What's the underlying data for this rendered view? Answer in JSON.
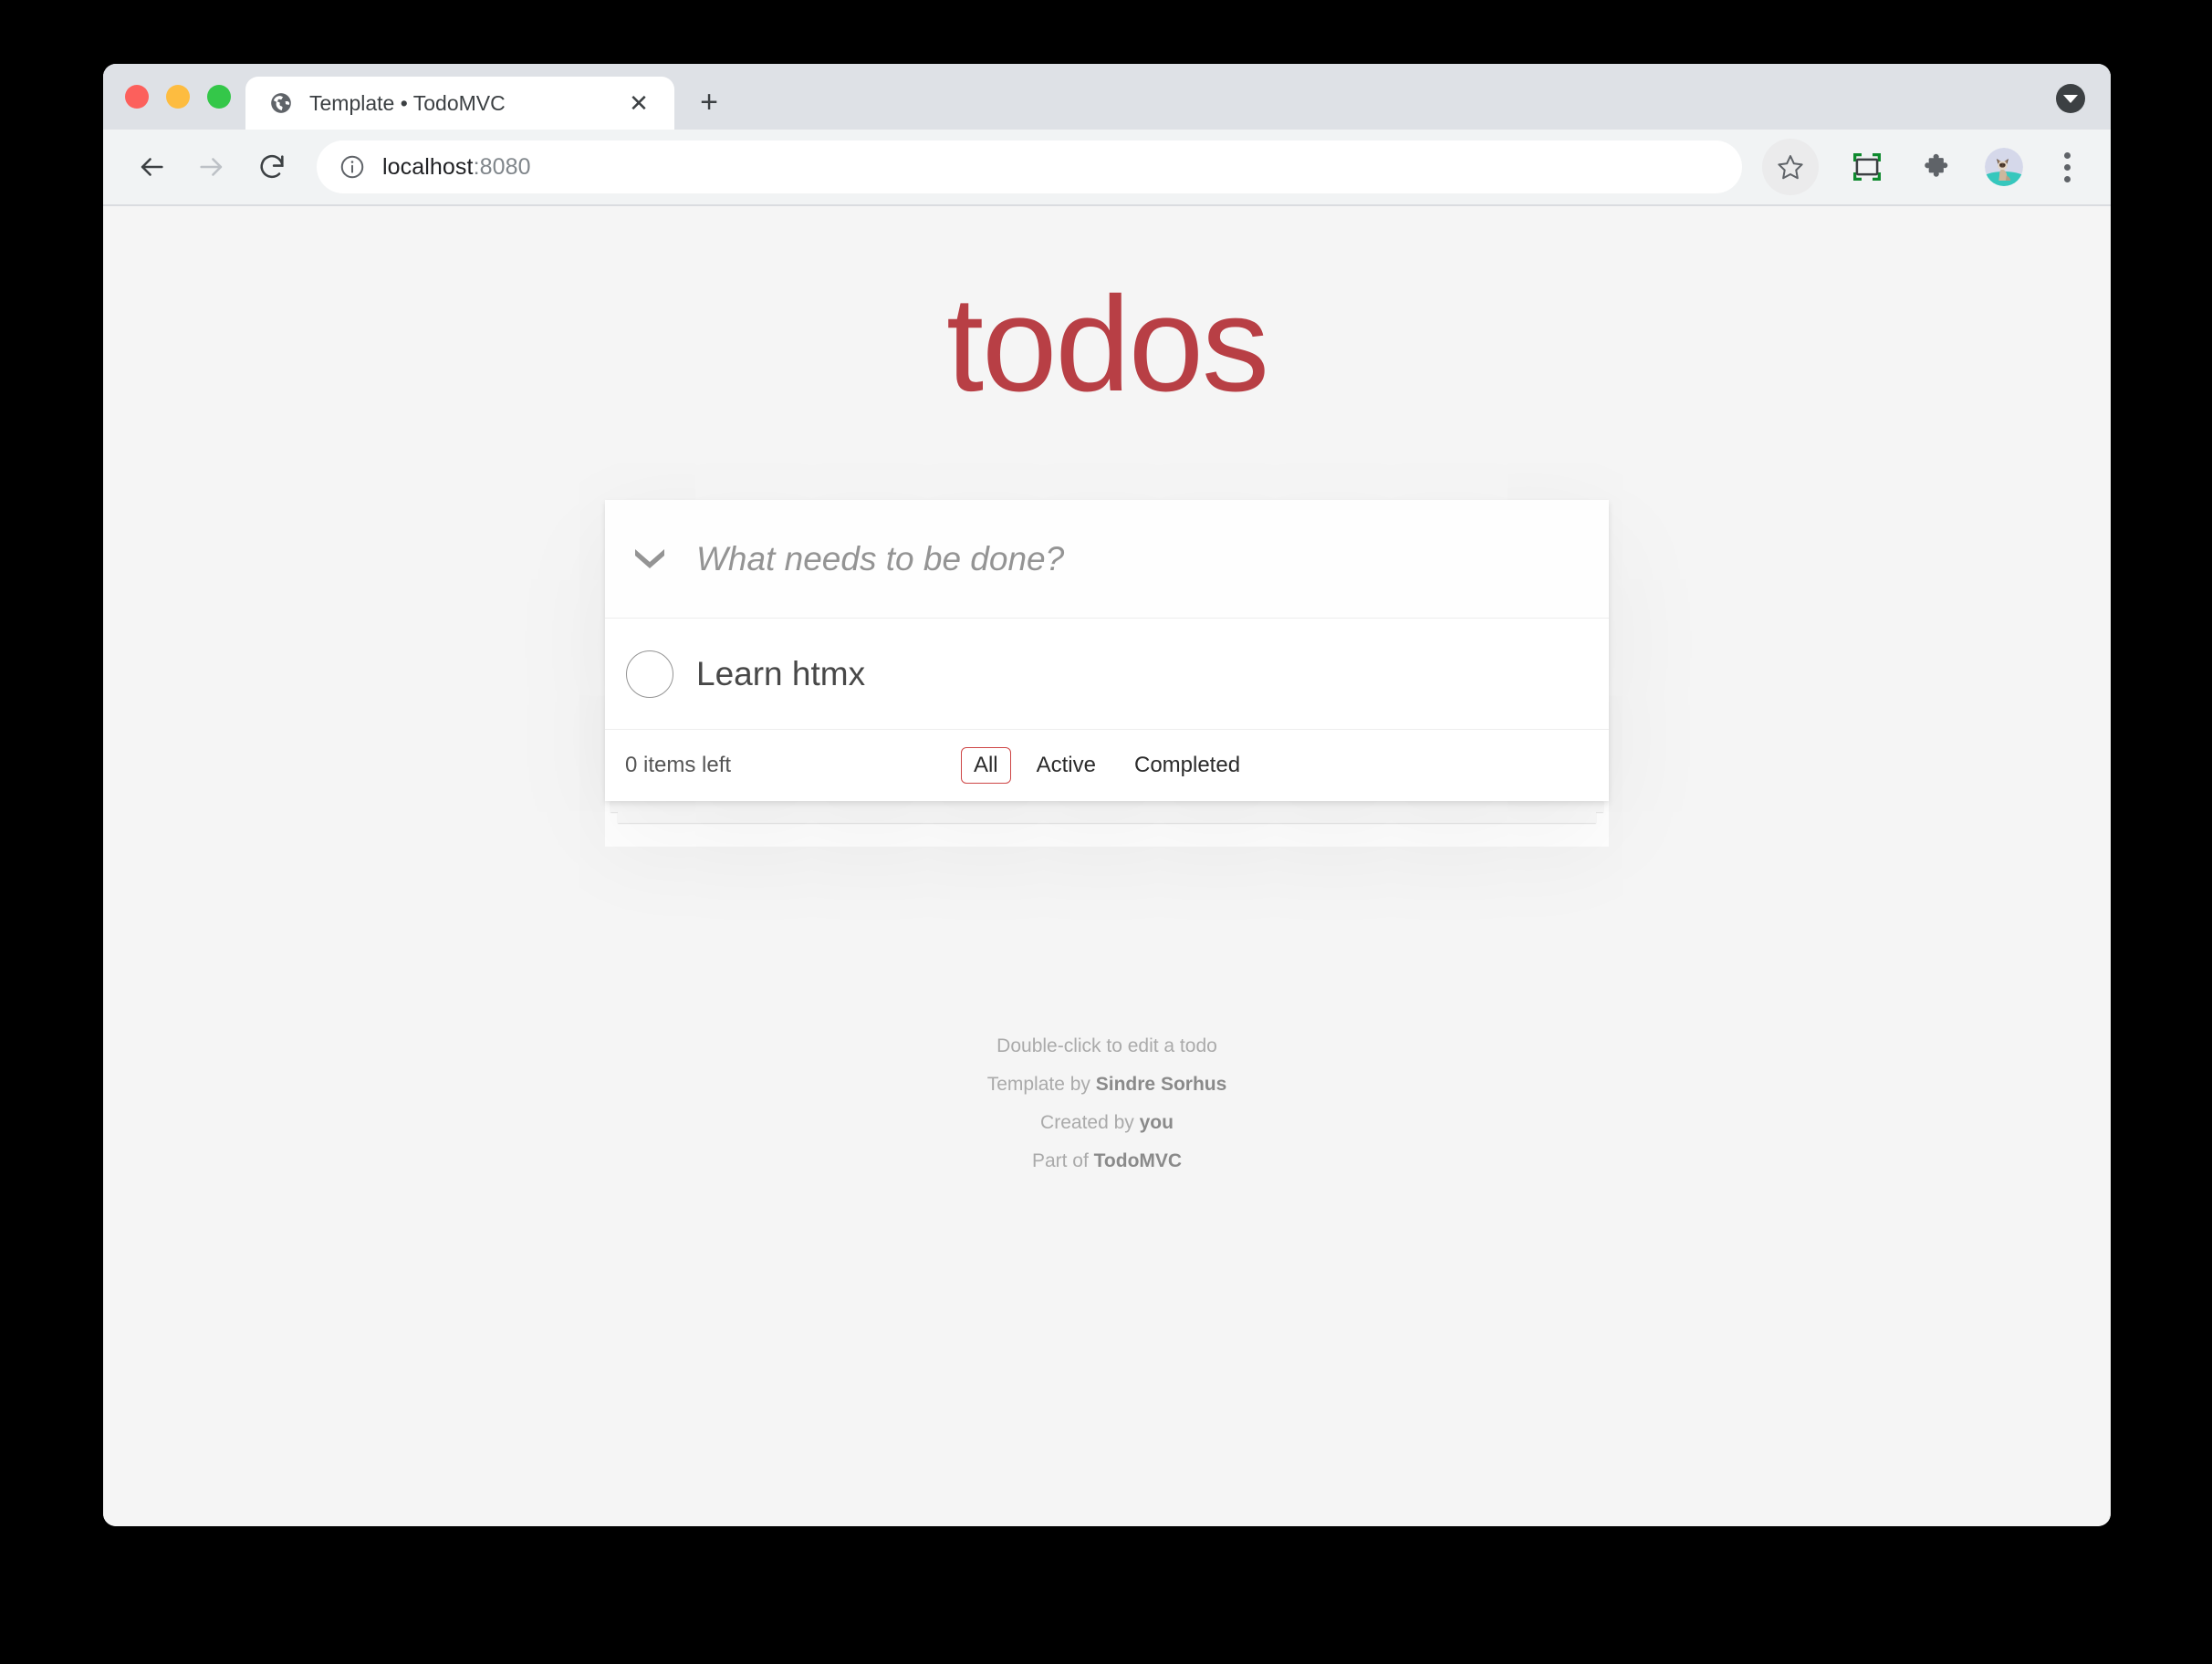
{
  "window": {
    "traffic_lights": [
      "close",
      "minimize",
      "zoom"
    ]
  },
  "tab": {
    "title": "Template • TodoMVC",
    "favicon": "globe-icon",
    "close_label": "✕",
    "new_tab_label": "+"
  },
  "toolbar": {
    "back_label": "←",
    "forward_label": "→",
    "reload_label": "⟳",
    "url_host": "localhost",
    "url_port": ":8080",
    "url_full": "localhost:8080",
    "info_icon": "info-circle-icon",
    "star_icon": "bookmark-star-icon",
    "capture_icon": "screen-capture-icon",
    "extensions_icon": "puzzle-piece-icon",
    "avatar_icon": "cat-avatar",
    "menu_icon": "three-dot-menu-icon"
  },
  "app": {
    "title": "todos",
    "title_color": "#b83f45",
    "toggle_all_icon": "chevron-down-icon",
    "new_todo_placeholder": "What needs to be done?",
    "new_todo_value": "",
    "todos": [
      {
        "label": "Learn htmx",
        "completed": false
      }
    ],
    "footer": {
      "count_text": "0 items left",
      "filters": [
        {
          "label": "All",
          "selected": true
        },
        {
          "label": "Active",
          "selected": false
        },
        {
          "label": "Completed",
          "selected": false
        }
      ],
      "selected_border_color": "#ce4646"
    }
  },
  "info": {
    "line1": "Double-click to edit a todo",
    "line2_prefix": "Template by ",
    "line2_link": "Sindre Sorhus",
    "line3_prefix": "Created by ",
    "line3_link": "you",
    "line4_prefix": "Part of ",
    "line4_link": "TodoMVC"
  }
}
